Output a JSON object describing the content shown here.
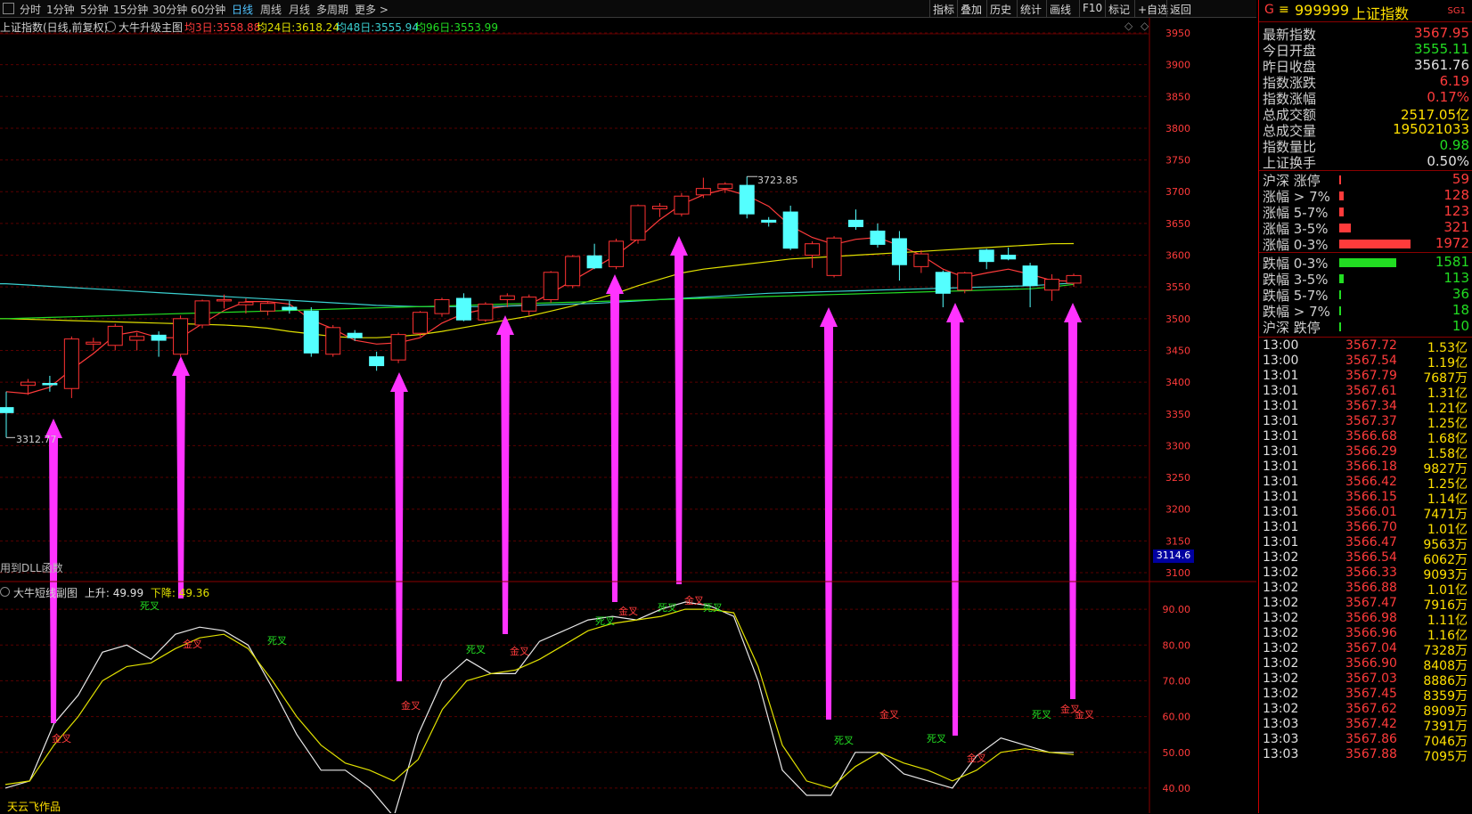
{
  "toolbar": {
    "periods": [
      "分时",
      "1分钟",
      "5分钟",
      "15分钟",
      "30分钟",
      "60分钟",
      "日线",
      "周线",
      "月线",
      "多周期",
      "更多 >"
    ],
    "active_period": "日线",
    "tools": [
      "指标",
      "叠加",
      "历史",
      "统计",
      "画线",
      "F10",
      "标记",
      "+自选",
      "返回"
    ]
  },
  "main_chart": {
    "title": "上证指数(日线,前复权)",
    "indicator": "大牛升级主图",
    "ma3_label": "均3日:",
    "ma3_value": "3558.88",
    "ma24_label": "均24日:",
    "ma24_value": "3618.24",
    "ma48_label": "均48日:",
    "ma48_value": "3555.94",
    "ma96_label": "均96日:",
    "ma96_value": "3553.99",
    "high_marker": "3723.85",
    "low_marker": "3312.77",
    "dll_note": "用到DLL函数",
    "price_axis": [
      "3950",
      "3900",
      "3850",
      "3800",
      "3750",
      "3700",
      "3650",
      "3600",
      "3550",
      "3500",
      "3450",
      "3400",
      "3350",
      "3300",
      "3250",
      "3200",
      "3150",
      "3100"
    ],
    "cursor_price": "3114.6"
  },
  "sub_chart": {
    "title": "大牛短线副图",
    "up_label": "上升:",
    "up_value": "49.99",
    "down_label": "下降:",
    "down_value": "49.36",
    "axis": [
      "90.00",
      "80.00",
      "70.00",
      "60.00",
      "50.00",
      "40.00"
    ],
    "author": "天云飞作品",
    "cross_labels": [
      "金叉",
      "死叉",
      "金叉",
      "死叉",
      "金叉",
      "死叉",
      "金叉",
      "死叉",
      "金叉",
      "死叉",
      "死叉",
      "金叉",
      "死叉",
      "金叉",
      "金叉",
      "死叉",
      "金叉",
      "死叉",
      "金叉"
    ]
  },
  "colors": {
    "up": "#ff3232",
    "down": "#54ffff",
    "ma3": "#ff3b3b",
    "ma24": "#e0e000",
    "ma48": "#3ad0d0",
    "ma96": "#22dd22",
    "arrow": "#ff33ff"
  },
  "chart_data": {
    "type": "candlestick",
    "title": "上证指数(日线,前复权)",
    "ylim": [
      3100,
      3950
    ],
    "candles": [
      {
        "o": 3360,
        "h": 3385,
        "l": 3312.77,
        "c": 3352
      },
      {
        "o": 3395,
        "h": 3405,
        "l": 3380,
        "c": 3400
      },
      {
        "o": 3398,
        "h": 3410,
        "l": 3385,
        "c": 3396
      },
      {
        "o": 3390,
        "h": 3472,
        "l": 3375,
        "c": 3468
      },
      {
        "o": 3460,
        "h": 3470,
        "l": 3450,
        "c": 3463
      },
      {
        "o": 3458,
        "h": 3492,
        "l": 3450,
        "c": 3488
      },
      {
        "o": 3466,
        "h": 3478,
        "l": 3450,
        "c": 3472
      },
      {
        "o": 3474,
        "h": 3480,
        "l": 3440,
        "c": 3466
      },
      {
        "o": 3444,
        "h": 3505,
        "l": 3440,
        "c": 3500
      },
      {
        "o": 3490,
        "h": 3530,
        "l": 3485,
        "c": 3528
      },
      {
        "o": 3528,
        "h": 3538,
        "l": 3516,
        "c": 3530
      },
      {
        "o": 3522,
        "h": 3532,
        "l": 3508,
        "c": 3526
      },
      {
        "o": 3512,
        "h": 3528,
        "l": 3505,
        "c": 3524
      },
      {
        "o": 3518,
        "h": 3528,
        "l": 3508,
        "c": 3514
      },
      {
        "o": 3512,
        "h": 3518,
        "l": 3440,
        "c": 3446
      },
      {
        "o": 3444,
        "h": 3490,
        "l": 3440,
        "c": 3486
      },
      {
        "o": 3477,
        "h": 3482,
        "l": 3465,
        "c": 3470
      },
      {
        "o": 3440,
        "h": 3448,
        "l": 3418,
        "c": 3426
      },
      {
        "o": 3435,
        "h": 3478,
        "l": 3430,
        "c": 3475
      },
      {
        "o": 3477,
        "h": 3512,
        "l": 3472,
        "c": 3510
      },
      {
        "o": 3508,
        "h": 3533,
        "l": 3503,
        "c": 3530
      },
      {
        "o": 3532,
        "h": 3540,
        "l": 3496,
        "c": 3498
      },
      {
        "o": 3498,
        "h": 3526,
        "l": 3495,
        "c": 3523
      },
      {
        "o": 3530,
        "h": 3540,
        "l": 3518,
        "c": 3536
      },
      {
        "o": 3512,
        "h": 3538,
        "l": 3505,
        "c": 3534
      },
      {
        "o": 3530,
        "h": 3575,
        "l": 3525,
        "c": 3573
      },
      {
        "o": 3552,
        "h": 3600,
        "l": 3548,
        "c": 3598
      },
      {
        "o": 3599,
        "h": 3618,
        "l": 3578,
        "c": 3580
      },
      {
        "o": 3582,
        "h": 3626,
        "l": 3578,
        "c": 3622
      },
      {
        "o": 3624,
        "h": 3680,
        "l": 3618,
        "c": 3678
      },
      {
        "o": 3673,
        "h": 3682,
        "l": 3660,
        "c": 3677
      },
      {
        "o": 3665,
        "h": 3698,
        "l": 3661,
        "c": 3693
      },
      {
        "o": 3695,
        "h": 3722,
        "l": 3690,
        "c": 3705
      },
      {
        "o": 3705,
        "h": 3715,
        "l": 3698,
        "c": 3712
      },
      {
        "o": 3710,
        "h": 3723.85,
        "l": 3658,
        "c": 3665
      },
      {
        "o": 3655,
        "h": 3660,
        "l": 3645,
        "c": 3652
      },
      {
        "o": 3668,
        "h": 3678,
        "l": 3608,
        "c": 3611
      },
      {
        "o": 3600,
        "h": 3622,
        "l": 3580,
        "c": 3618
      },
      {
        "o": 3568,
        "h": 3630,
        "l": 3565,
        "c": 3627
      },
      {
        "o": 3655,
        "h": 3672,
        "l": 3640,
        "c": 3645
      },
      {
        "o": 3638,
        "h": 3650,
        "l": 3612,
        "c": 3617
      },
      {
        "o": 3626,
        "h": 3638,
        "l": 3560,
        "c": 3585
      },
      {
        "o": 3582,
        "h": 3608,
        "l": 3572,
        "c": 3602
      },
      {
        "o": 3573,
        "h": 3576,
        "l": 3518,
        "c": 3540
      },
      {
        "o": 3545,
        "h": 3574,
        "l": 3540,
        "c": 3572
      },
      {
        "o": 3608,
        "h": 3610,
        "l": 3578,
        "c": 3590
      },
      {
        "o": 3600,
        "h": 3612,
        "l": 3592,
        "c": 3594
      },
      {
        "o": 3583,
        "h": 3588,
        "l": 3518,
        "c": 3552
      },
      {
        "o": 3545,
        "h": 3570,
        "l": 3528,
        "c": 3562
      },
      {
        "o": 3556,
        "h": 3571,
        "l": 3550,
        "c": 3567.95
      }
    ],
    "ma": {
      "ma3": [
        3385,
        3382,
        3392,
        3420,
        3445,
        3474,
        3480,
        3470,
        3470,
        3492,
        3513,
        3527,
        3527,
        3523,
        3498,
        3484,
        3466,
        3460,
        3462,
        3470,
        3493,
        3508,
        3515,
        3520,
        3522,
        3540,
        3560,
        3580,
        3600,
        3626,
        3656,
        3680,
        3695,
        3704,
        3694,
        3677,
        3646,
        3628,
        3617,
        3625,
        3628,
        3615,
        3600,
        3578,
        3565,
        3572,
        3578,
        3570,
        3560,
        3558.88
      ],
      "ma24": [
        3500,
        3499,
        3498,
        3497,
        3496,
        3495,
        3494,
        3493,
        3492,
        3491,
        3490,
        3488,
        3485,
        3480,
        3476,
        3472,
        3470,
        3470,
        3472,
        3475,
        3480,
        3486,
        3492,
        3498,
        3504,
        3512,
        3520,
        3530,
        3540,
        3552,
        3562,
        3572,
        3578,
        3582,
        3586,
        3590,
        3594,
        3596,
        3598,
        3600,
        3602,
        3604,
        3606,
        3608,
        3610,
        3612,
        3614,
        3616,
        3618,
        3618.24
      ],
      "ma48": [
        3555,
        3553,
        3551,
        3549,
        3547,
        3545,
        3543,
        3541,
        3539,
        3537,
        3535,
        3533,
        3531,
        3529,
        3527,
        3525,
        3523,
        3521,
        3520,
        3519,
        3519,
        3519,
        3519,
        3520,
        3521,
        3522,
        3523,
        3524,
        3526,
        3528,
        3530,
        3532,
        3534,
        3536,
        3538,
        3540,
        3541,
        3542,
        3543,
        3544,
        3545,
        3546,
        3547,
        3548,
        3549,
        3550,
        3551,
        3552,
        3554,
        3555.94
      ],
      "ma96": [
        3500,
        3501,
        3502,
        3503,
        3504,
        3505,
        3506,
        3507,
        3508,
        3509,
        3510,
        3511,
        3512,
        3513,
        3514,
        3515,
        3516,
        3517,
        3518,
        3519,
        3520,
        3521,
        3522,
        3523,
        3524,
        3525,
        3526,
        3527,
        3528,
        3529,
        3530,
        3531,
        3532,
        3533,
        3534,
        3535,
        3536,
        3537,
        3538,
        3539,
        3540,
        3541,
        3542,
        3543,
        3544,
        3545,
        3546,
        3547,
        3550,
        3553.99
      ]
    },
    "sub": {
      "ylim": [
        35,
        95
      ],
      "up": [
        40,
        42,
        58,
        66,
        78,
        80,
        76,
        83,
        85,
        84,
        80,
        68,
        55,
        45,
        45,
        40,
        32,
        55,
        70,
        76,
        72,
        72,
        81,
        84,
        87,
        88,
        87,
        90,
        92,
        91,
        88,
        70,
        45,
        38,
        38,
        50,
        50,
        44,
        42,
        40,
        49,
        54,
        52,
        50,
        49.99
      ],
      "down": [
        41,
        42,
        52,
        60,
        70,
        74,
        75,
        79,
        82,
        83,
        79,
        70,
        60,
        52,
        47,
        45,
        42,
        48,
        62,
        70,
        72,
        73,
        76,
        80,
        84,
        86,
        87,
        88,
        90,
        90,
        89,
        74,
        52,
        42,
        40,
        46,
        50,
        47,
        45,
        42,
        45,
        50,
        51,
        50,
        49.36
      ]
    }
  },
  "quote_panel": {
    "prefix": "G",
    "code": "999999",
    "name": "上证指数",
    "tag": "SG1",
    "stats": [
      {
        "label": "最新指数",
        "value": "3567.95",
        "color": "#ff3b3b"
      },
      {
        "label": "今日开盘",
        "value": "3555.11",
        "color": "#22dd22"
      },
      {
        "label": "昨日收盘",
        "value": "3561.76",
        "color": "#e0e0e0"
      },
      {
        "label": "指数涨跌",
        "value": "6.19",
        "color": "#ff3b3b"
      },
      {
        "label": "指数涨幅",
        "value": "0.17%",
        "color": "#ff3b3b"
      },
      {
        "label": "总成交额",
        "value": "2517.05亿",
        "color": "#ffe000"
      },
      {
        "label": "总成交量",
        "value": "195021033",
        "color": "#ffe000"
      },
      {
        "label": "指数量比",
        "value": "0.98",
        "color": "#22dd22"
      },
      {
        "label": "上证换手",
        "value": "0.50%",
        "color": "#e0e0e0"
      }
    ],
    "breadth": [
      {
        "label": "沪深 涨停",
        "value": "59",
        "color": "#ff3b3b",
        "frac": 0.03
      },
      {
        "label": "涨幅 > 7%",
        "value": "128",
        "color": "#ff3b3b",
        "frac": 0.065
      },
      {
        "label": "涨幅 5-7%",
        "value": "123",
        "color": "#ff3b3b",
        "frac": 0.062
      },
      {
        "label": "涨幅 3-5%",
        "value": "321",
        "color": "#ff3b3b",
        "frac": 0.163
      },
      {
        "label": "涨幅 0-3%",
        "value": "1972",
        "color": "#ff3b3b",
        "frac": 1.0
      },
      {
        "label": "跌幅 0-3%",
        "value": "1581",
        "color": "#22dd22",
        "frac": 0.8
      },
      {
        "label": "跌幅 3-5%",
        "value": "113",
        "color": "#22dd22",
        "frac": 0.057
      },
      {
        "label": "跌幅 5-7%",
        "value": "36",
        "color": "#22dd22",
        "frac": 0.018
      },
      {
        "label": "跌幅 > 7%",
        "value": "18",
        "color": "#22dd22",
        "frac": 0.009
      },
      {
        "label": "沪深 跌停",
        "value": "10",
        "color": "#22dd22",
        "frac": 0.005
      }
    ],
    "ticks": [
      {
        "time": "13:00",
        "price": "3567.72",
        "amount": "1.53亿"
      },
      {
        "time": "13:00",
        "price": "3567.54",
        "amount": "1.19亿"
      },
      {
        "time": "13:01",
        "price": "3567.79",
        "amount": "7687万"
      },
      {
        "time": "13:01",
        "price": "3567.61",
        "amount": "1.31亿"
      },
      {
        "time": "13:01",
        "price": "3567.34",
        "amount": "1.21亿"
      },
      {
        "time": "13:01",
        "price": "3567.37",
        "amount": "1.25亿"
      },
      {
        "time": "13:01",
        "price": "3566.68",
        "amount": "1.68亿"
      },
      {
        "time": "13:01",
        "price": "3566.29",
        "amount": "1.58亿"
      },
      {
        "time": "13:01",
        "price": "3566.18",
        "amount": "9827万"
      },
      {
        "time": "13:01",
        "price": "3566.42",
        "amount": "1.25亿"
      },
      {
        "time": "13:01",
        "price": "3566.15",
        "amount": "1.14亿"
      },
      {
        "time": "13:01",
        "price": "3566.01",
        "amount": "7471万"
      },
      {
        "time": "13:01",
        "price": "3566.70",
        "amount": "1.01亿"
      },
      {
        "time": "13:01",
        "price": "3566.47",
        "amount": "9563万"
      },
      {
        "time": "13:02",
        "price": "3566.54",
        "amount": "6062万"
      },
      {
        "time": "13:02",
        "price": "3566.33",
        "amount": "9093万"
      },
      {
        "time": "13:02",
        "price": "3566.88",
        "amount": "1.01亿"
      },
      {
        "time": "13:02",
        "price": "3567.47",
        "amount": "7916万"
      },
      {
        "time": "13:02",
        "price": "3566.98",
        "amount": "1.11亿"
      },
      {
        "time": "13:02",
        "price": "3566.96",
        "amount": "1.16亿"
      },
      {
        "time": "13:02",
        "price": "3567.04",
        "amount": "7328万"
      },
      {
        "time": "13:02",
        "price": "3566.90",
        "amount": "8408万"
      },
      {
        "time": "13:02",
        "price": "3567.03",
        "amount": "8886万"
      },
      {
        "time": "13:02",
        "price": "3567.45",
        "amount": "8359万"
      },
      {
        "time": "13:02",
        "price": "3567.62",
        "amount": "8909万"
      },
      {
        "time": "13:03",
        "price": "3567.42",
        "amount": "7391万"
      },
      {
        "time": "13:03",
        "price": "3567.86",
        "amount": "7046万"
      },
      {
        "time": "13:03",
        "price": "3567.88",
        "amount": "7095万"
      }
    ]
  }
}
